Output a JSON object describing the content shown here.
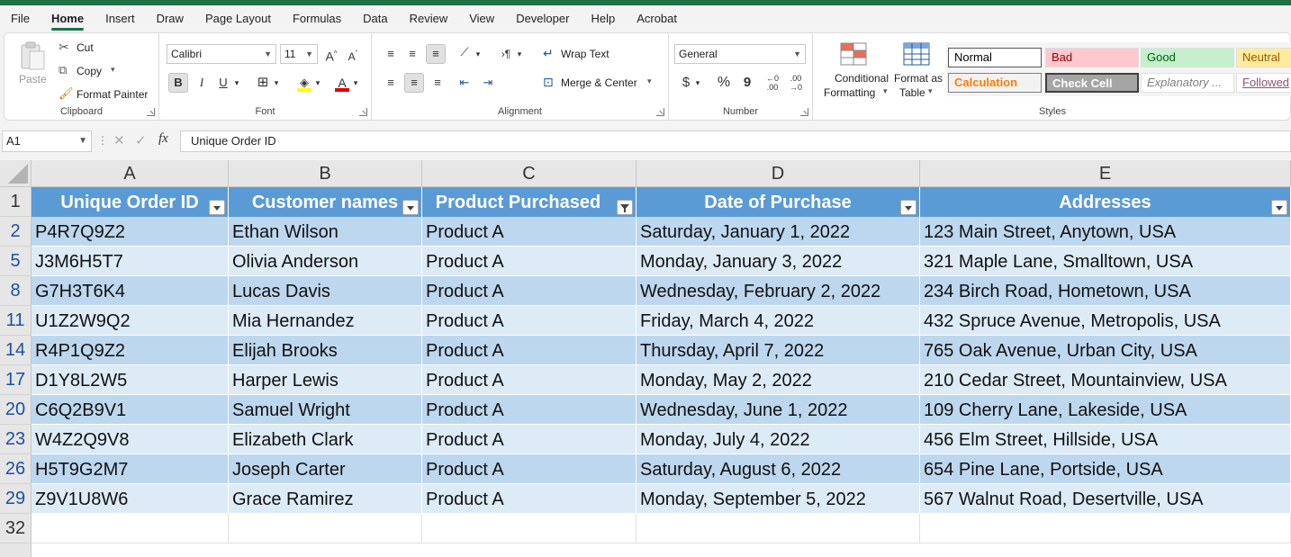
{
  "menu": {
    "tabs": [
      "File",
      "Home",
      "Insert",
      "Draw",
      "Page Layout",
      "Formulas",
      "Data",
      "Review",
      "View",
      "Developer",
      "Help",
      "Acrobat"
    ],
    "active": "Home"
  },
  "ribbon": {
    "clipboard": {
      "label": "Clipboard",
      "paste": "Paste",
      "cut": "Cut",
      "copy": "Copy",
      "format_painter": "Format Painter"
    },
    "font": {
      "label": "Font",
      "name": "Calibri",
      "size": "11",
      "bold": "B",
      "italic": "I",
      "underline": "U"
    },
    "alignment": {
      "label": "Alignment",
      "wrap_text": "Wrap Text",
      "merge_center": "Merge & Center"
    },
    "number": {
      "label": "Number",
      "format": "General",
      "currency": "$",
      "percent": "%",
      "comma": "9"
    },
    "styles": {
      "label": "Styles",
      "conditional_formatting_line1": "Conditional",
      "conditional_formatting_line2": "Formatting",
      "format_as_table_line1": "Format as",
      "format_as_table_line2": "Table",
      "cells": [
        {
          "text": "Normal",
          "bg": "#ffffff",
          "fg": "#000000"
        },
        {
          "text": "Bad",
          "bg": "#ffc7ce",
          "fg": "#9c0006"
        },
        {
          "text": "Good",
          "bg": "#c6efce",
          "fg": "#006100"
        },
        {
          "text": "Neutral",
          "bg": "#ffeb9c",
          "fg": "#9c5700"
        },
        {
          "text": "Calculation",
          "bg": "#f2f2f2",
          "fg": "#fa7d00"
        },
        {
          "text": "Check Cell",
          "bg": "#a5a5a5",
          "fg": "#ffffff"
        },
        {
          "text": "Explanatory ...",
          "bg": "#ffffff",
          "fg": "#7f7f7f"
        },
        {
          "text": "Followed",
          "bg": "#ffffff",
          "fg": "#954f72"
        }
      ]
    }
  },
  "formula_bar": {
    "name_box": "A1",
    "fx": "fx",
    "content": "Unique Order ID"
  },
  "sheet": {
    "columns": [
      "A",
      "B",
      "C",
      "D",
      "E"
    ],
    "header_row_number": "1",
    "headers": [
      "Unique Order ID",
      "Customer names",
      "Product Purchased",
      "Date of Purchase",
      "Addresses"
    ],
    "rows": [
      {
        "num": "2",
        "cells": [
          "P4R7Q9Z2",
          "Ethan Wilson",
          "Product A",
          "Saturday, January 1, 2022",
          "123 Main Street, Anytown, USA"
        ]
      },
      {
        "num": "5",
        "cells": [
          "J3M6H5T7",
          "Olivia Anderson",
          "Product A",
          "Monday, January 3, 2022",
          "321 Maple Lane, Smalltown, USA"
        ]
      },
      {
        "num": "8",
        "cells": [
          "G7H3T6K4",
          "Lucas Davis",
          "Product A",
          "Wednesday, February 2, 2022",
          "234 Birch Road, Hometown, USA"
        ]
      },
      {
        "num": "11",
        "cells": [
          "U1Z2W9Q2",
          "Mia Hernandez",
          "Product A",
          "Friday, March 4, 2022",
          "432 Spruce Avenue, Metropolis, USA"
        ]
      },
      {
        "num": "14",
        "cells": [
          "R4P1Q9Z2",
          "Elijah Brooks",
          "Product A",
          "Thursday, April 7, 2022",
          "765 Oak Avenue, Urban City, USA"
        ]
      },
      {
        "num": "17",
        "cells": [
          "D1Y8L2W5",
          "Harper Lewis",
          "Product A",
          "Monday, May 2, 2022",
          "210 Cedar Street, Mountainview, USA"
        ]
      },
      {
        "num": "20",
        "cells": [
          "C6Q2B9V1",
          "Samuel Wright",
          "Product A",
          "Wednesday, June 1, 2022",
          "109 Cherry Lane, Lakeside, USA"
        ]
      },
      {
        "num": "23",
        "cells": [
          "W4Z2Q9V8",
          "Elizabeth Clark",
          "Product A",
          "Monday, July 4, 2022",
          "456 Elm Street, Hillside, USA"
        ]
      },
      {
        "num": "26",
        "cells": [
          "H5T9G2M7",
          "Joseph Carter",
          "Product A",
          "Saturday, August 6, 2022",
          "654 Pine Lane, Portside, USA"
        ]
      },
      {
        "num": "29",
        "cells": [
          "Z9V1U8W6",
          "Grace Ramirez",
          "Product A",
          "Monday, September 5, 2022",
          "567 Walnut Road, Desertville, USA"
        ]
      }
    ],
    "empty_rows": [
      "32"
    ],
    "colors": {
      "header_bg": "#5b9bd5",
      "band1": "#bdd7ee",
      "band2": "#ddebf7",
      "row_number_filtered": "#1f4fa3"
    }
  }
}
